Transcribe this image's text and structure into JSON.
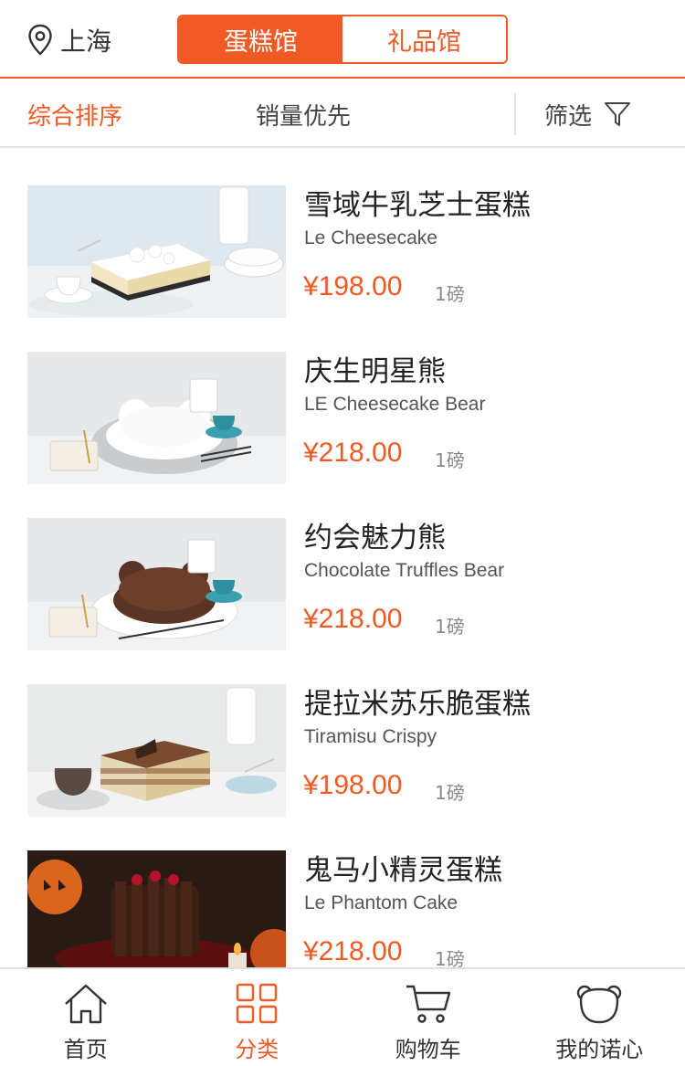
{
  "header": {
    "location": "上海",
    "segments": [
      {
        "label": "蛋糕馆",
        "active": true
      },
      {
        "label": "礼品馆",
        "active": false
      }
    ]
  },
  "sort": {
    "options": [
      "综合排序",
      "销量优先"
    ],
    "filter_label": "筛选"
  },
  "products": [
    {
      "name": "雪域牛乳芝士蛋糕",
      "english": "Le Cheesecake",
      "price": "¥198.00",
      "weight": "1磅"
    },
    {
      "name": "庆生明星熊",
      "english": "LE Cheesecake Bear",
      "price": "¥218.00",
      "weight": "1磅"
    },
    {
      "name": "约会魅力熊",
      "english": "Chocolate Truffles Bear",
      "price": "¥218.00",
      "weight": "1磅"
    },
    {
      "name": "提拉米苏乐脆蛋糕",
      "english": "Tiramisu Crispy",
      "price": "¥198.00",
      "weight": "1磅"
    },
    {
      "name": "鬼马小精灵蛋糕",
      "english": "Le Phantom Cake",
      "price": "¥218.00",
      "weight": "1磅"
    }
  ],
  "tabs": [
    {
      "label": "首页",
      "icon": "home-icon"
    },
    {
      "label": "分类",
      "icon": "grid-icon",
      "active": true
    },
    {
      "label": "购物车",
      "icon": "cart-icon"
    },
    {
      "label": "我的诺心",
      "icon": "bear-icon"
    }
  ],
  "colors": {
    "accent": "#f05a24",
    "text": "#333333",
    "muted": "#888888",
    "divider": "#e3e3e3"
  }
}
